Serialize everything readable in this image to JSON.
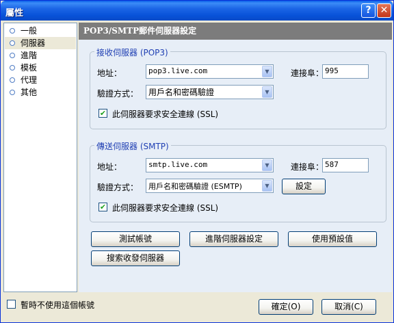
{
  "window": {
    "title": "屬性",
    "help_glyph": "?",
    "close_glyph": "✕"
  },
  "nav": {
    "items": [
      {
        "label": "一般"
      },
      {
        "label": "伺服器",
        "selected": true
      },
      {
        "label": "進階"
      },
      {
        "label": "模板"
      },
      {
        "label": "代理"
      },
      {
        "label": "其他"
      }
    ]
  },
  "panel": {
    "header": "POP3/SMTP郵件伺服器設定",
    "incoming": {
      "legend": "接收伺服器 (POP3)",
      "address_label": "地址：",
      "address_value": "pop3.live.com",
      "port_label": "連接阜：",
      "port_value": "995",
      "auth_label": "驗證方式：",
      "auth_value": "用戶名和密碼驗證",
      "ssl_label": "此伺服器要求安全連線 (SSL)",
      "ssl_checked": true
    },
    "outgoing": {
      "legend": "傳送伺服器 (SMTP)",
      "address_label": "地址：",
      "address_value": "smtp.live.com",
      "port_label": "連接阜：",
      "port_value": "587",
      "auth_label": "驗證方式：",
      "auth_value": "用戶名和密碼驗證 (ESMTP)",
      "settings_button": "設定",
      "ssl_label": "此伺服器要求安全連線 (SSL)",
      "ssl_checked": true
    },
    "buttons": {
      "test_account": "測試帳號",
      "advanced_server": "進階伺服器設定",
      "use_defaults": "使用預設值",
      "search_server": "搜索收發伺服器"
    }
  },
  "footer": {
    "disable_label": "暫時不使用這個帳號",
    "ok_label": "確定(O)",
    "cancel_label": "取消(C)"
  },
  "glyphs": {
    "check": "✔",
    "dropdown": "▼"
  }
}
